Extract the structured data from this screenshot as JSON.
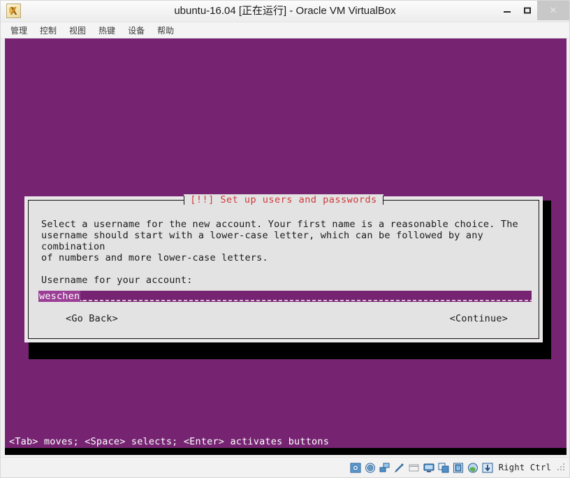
{
  "window": {
    "title": "ubuntu-16.04 [正在运行] - Oracle VM VirtualBox",
    "app_icon": "virtualbox-logo-icon",
    "buttons": {
      "minimize": "minimize-icon",
      "maximize": "maximize-icon",
      "close": "✕"
    }
  },
  "menubar": {
    "items": [
      {
        "label": "管理",
        "name": "menu-file"
      },
      {
        "label": "控制",
        "name": "menu-machine"
      },
      {
        "label": "视图",
        "name": "menu-view"
      },
      {
        "label": "热键",
        "name": "menu-input"
      },
      {
        "label": "设备",
        "name": "menu-devices"
      },
      {
        "label": "帮助",
        "name": "menu-help"
      }
    ]
  },
  "guest": {
    "background_color": "#762472",
    "dialog": {
      "title": "[!!] Set up users and passwords",
      "title_color": "#cf3a3a",
      "paragraph": "Select a username for the new account. Your first name is a reasonable choice. The\nusername should start with a lower-case letter, which can be followed by any combination\nof numbers and more lower-case letters.",
      "prompt": "Username for your account:",
      "input": {
        "value": "weschen",
        "cursor": "_",
        "highlight_color": "#9b3f96",
        "track_color": "#762472"
      },
      "buttons": {
        "back": "<Go Back>",
        "continue": "<Continue>"
      }
    },
    "hint": "<Tab> moves; <Space> selects; <Enter> activates buttons"
  },
  "statusbar": {
    "icons": [
      "hard-disk-icon",
      "optical-disk-icon",
      "network-icon",
      "usb-icon",
      "shared-folder-icon",
      "display-icon",
      "drag-drop-icon",
      "cpu-icon",
      "globe-icon",
      "down-arrow-icon"
    ],
    "host_key": "Right Ctrl",
    "grip": "resize-grip-icon"
  }
}
